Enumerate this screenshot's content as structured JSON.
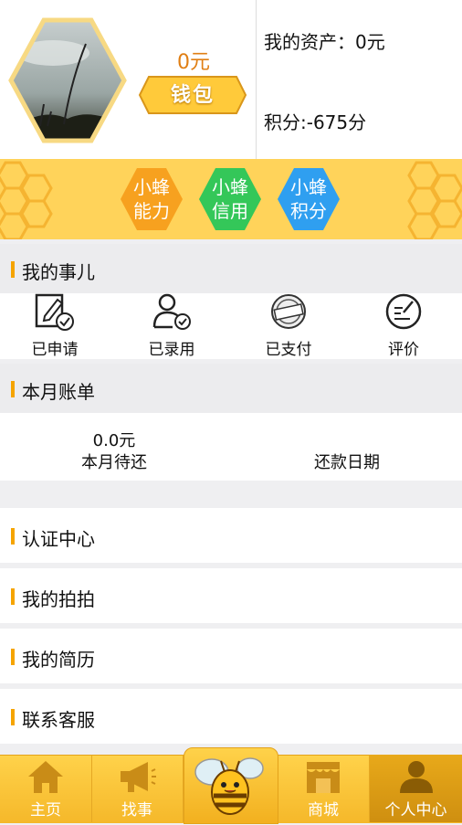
{
  "profile": {
    "balance": "0元",
    "wallet_label": "钱包",
    "assets": "我的资产：0元",
    "points": "积分:-675分"
  },
  "badges": [
    {
      "line1": "小蜂",
      "line2": "能力",
      "color": "#f7a11f"
    },
    {
      "line1": "小蜂",
      "line2": "信用",
      "color": "#34c759"
    },
    {
      "line1": "小蜂",
      "line2": "积分",
      "color": "#2f9ff0"
    }
  ],
  "my_affairs": {
    "title": "我的事儿",
    "actions": [
      {
        "label": "已申请",
        "icon": "applied-icon"
      },
      {
        "label": "已录用",
        "icon": "hired-icon"
      },
      {
        "label": "已支付",
        "icon": "paid-stamp-icon"
      },
      {
        "label": "评价",
        "icon": "review-icon"
      }
    ]
  },
  "monthly_bill": {
    "title": "本月账单",
    "amount": "0.0元",
    "amount_label": "本月待还",
    "due_label": "还款日期"
  },
  "menu": [
    {
      "label": "认证中心"
    },
    {
      "label": "我的拍拍"
    },
    {
      "label": "我的简历"
    },
    {
      "label": "联系客服"
    }
  ],
  "tabs": [
    {
      "label": "主页",
      "icon": "home-icon"
    },
    {
      "label": "找事",
      "icon": "megaphone-icon"
    },
    {
      "label": "",
      "icon": "bee-mascot-icon"
    },
    {
      "label": "商城",
      "icon": "store-icon"
    },
    {
      "label": "个人中心",
      "icon": "person-icon",
      "active": true
    }
  ],
  "colors": {
    "accent": "#f5a400",
    "band": "#ffd35a",
    "balance": "#e07f14"
  }
}
